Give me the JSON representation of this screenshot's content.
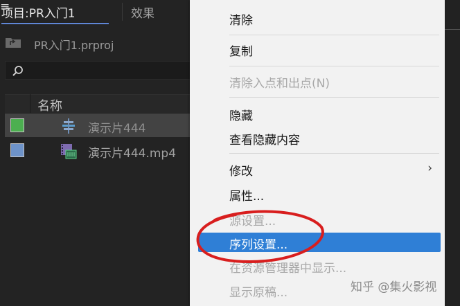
{
  "project_panel": {
    "tab_title": "项目:PR入门1",
    "tab_menu_icon": "≡",
    "tab_effects": "效果",
    "path_text": "PR入门1.prproj",
    "column_name": "名称",
    "items": [
      {
        "name": "演示片444",
        "color": "#4caf50",
        "icon": "sequence-icon"
      },
      {
        "name": "演示片444.mp4",
        "color": "#6e93c9",
        "icon": "video-clip-icon"
      }
    ]
  },
  "context_menu": {
    "items": [
      {
        "label": "清除",
        "enabled": true
      },
      {
        "label": "复制",
        "enabled": true
      },
      {
        "label": "清除入点和出点(N)",
        "enabled": false
      },
      {
        "label": "隐藏",
        "enabled": true
      },
      {
        "label": "查看隐藏内容",
        "enabled": true
      },
      {
        "label": "修改",
        "enabled": true,
        "submenu_arrow": "›"
      },
      {
        "label": "属性...",
        "enabled": true
      },
      {
        "label": "源设置...",
        "enabled": false
      },
      {
        "label": "序列设置...",
        "enabled": true,
        "highlighted": true
      },
      {
        "label": "在资源管理器中显示...",
        "enabled": false
      },
      {
        "label": "显示原稿...",
        "enabled": false
      }
    ]
  },
  "watermark": "知乎 @集火影视",
  "colors": {
    "highlight": "#2f7fd6",
    "annotation": "#d81e1e",
    "tab_underline": "#5f86d6"
  }
}
